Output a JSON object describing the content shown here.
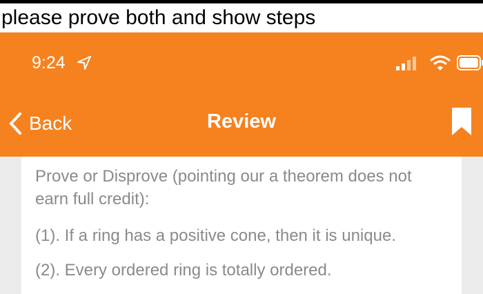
{
  "caption": "please prove both and show steps",
  "status_bar": {
    "time": "9:24",
    "icons": [
      "location-arrow-icon",
      "signal-icon",
      "wifi-icon",
      "battery-icon"
    ]
  },
  "nav": {
    "back_label": "Back",
    "title": "Review",
    "icons": [
      "chevron-left-icon",
      "bookmark-icon"
    ]
  },
  "content": {
    "instruction": "Prove or Disprove (pointing our a theorem does not earn full credit):",
    "item1": "(1). If a ring has a positive cone, then it is unique.",
    "item2": "(2). Every ordered ring is totally ordered."
  },
  "colors": {
    "accent": "#f5821f",
    "text_muted": "#8a8a8a",
    "background": "#ebebeb"
  }
}
